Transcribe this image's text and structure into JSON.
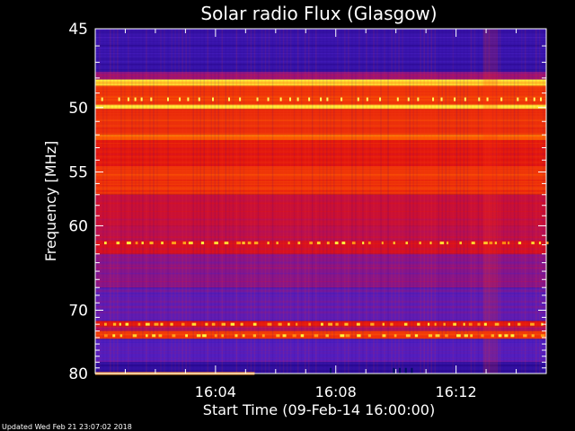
{
  "chart_data": {
    "type": "heatmap",
    "title": "Solar radio Flux (Glasgow)",
    "xlabel": "Start Time (09-Feb-14 16:00:00)",
    "ylabel": "Frequency [MHz]",
    "x_unit": "minutes after 16:00",
    "xlim": [
      0,
      15
    ],
    "ylim": [
      45,
      80
    ],
    "xticks": [
      {
        "value": 4,
        "label": "16:04"
      },
      {
        "value": 8,
        "label": "16:08"
      },
      {
        "value": 12,
        "label": "16:12"
      }
    ],
    "yticks": [
      {
        "value": 45,
        "label": "45"
      },
      {
        "value": 50,
        "label": "50"
      },
      {
        "value": 55,
        "label": "55"
      },
      {
        "value": 60,
        "label": "60"
      },
      {
        "value": 70,
        "label": "70"
      },
      {
        "value": 80,
        "label": "80"
      }
    ],
    "minor_yticks": [
      46,
      47,
      48,
      49,
      51,
      52,
      53,
      54,
      56,
      57,
      58,
      59,
      61,
      62,
      63,
      64,
      65,
      66,
      67,
      68,
      69,
      71,
      72,
      73,
      74,
      75,
      76,
      77,
      78,
      79
    ],
    "colormap": [
      "#1a0078",
      "#4a20c8",
      "#b01060",
      "#e01010",
      "#ff6000",
      "#ffff40"
    ],
    "frequency_bands": [
      {
        "from": 45.0,
        "to": 47.6,
        "level": 0.12
      },
      {
        "from": 47.6,
        "to": 48.1,
        "level": 0.35
      },
      {
        "from": 48.1,
        "to": 48.5,
        "level": 0.95
      },
      {
        "from": 48.5,
        "to": 49.8,
        "level": 0.7
      },
      {
        "from": 49.8,
        "to": 50.1,
        "level": 0.98
      },
      {
        "from": 50.1,
        "to": 52.0,
        "level": 0.68
      },
      {
        "from": 52.0,
        "to": 52.4,
        "level": 0.8
      },
      {
        "from": 52.4,
        "to": 54.5,
        "level": 0.62
      },
      {
        "from": 54.5,
        "to": 57.0,
        "level": 0.7
      },
      {
        "from": 57.0,
        "to": 60.0,
        "level": 0.5
      },
      {
        "from": 60.0,
        "to": 61.5,
        "level": 0.45
      },
      {
        "from": 61.5,
        "to": 63.0,
        "level": 0.55
      },
      {
        "from": 63.0,
        "to": 67.0,
        "level": 0.32
      },
      {
        "from": 67.0,
        "to": 71.5,
        "level": 0.25
      },
      {
        "from": 71.5,
        "to": 72.3,
        "level": 0.62
      },
      {
        "from": 72.3,
        "to": 73.0,
        "level": 0.38
      },
      {
        "from": 73.0,
        "to": 74.2,
        "level": 0.7
      },
      {
        "from": 74.2,
        "to": 78.0,
        "level": 0.22
      },
      {
        "from": 78.0,
        "to": 79.6,
        "level": 0.1
      },
      {
        "from": 79.6,
        "to": 80.0,
        "level": 0.08
      }
    ],
    "grid": false
  },
  "footer": {
    "updated": "Updated Wed Feb 21 23:07:02 2018"
  }
}
